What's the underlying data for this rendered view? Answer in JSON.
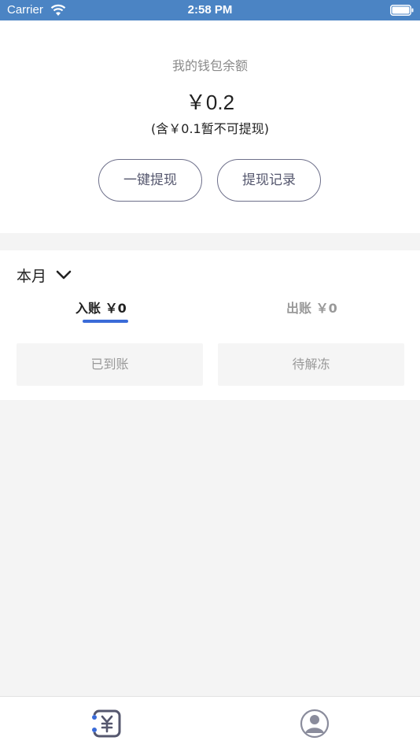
{
  "status_bar": {
    "carrier": "Carrier",
    "time": "2:58 PM"
  },
  "wallet": {
    "balance_label": "我的钱包余额",
    "balance_amount": "￥0.2",
    "balance_note": "(含￥0.1暂不可提现)",
    "withdraw_button": "一键提现",
    "records_button": "提现记录"
  },
  "monthly": {
    "period_label": "本月",
    "tabs": [
      {
        "label": "入账 ￥0",
        "active": true
      },
      {
        "label": "出账 ￥0",
        "active": false
      }
    ],
    "status_filters": [
      "已到账",
      "待解冻"
    ]
  },
  "tab_bar": {
    "items": [
      "wallet-icon",
      "profile-icon"
    ]
  },
  "colors": {
    "status_bar": "#4b84c4",
    "accent": "#3a6bd8",
    "button_border": "#6d6f8a"
  }
}
